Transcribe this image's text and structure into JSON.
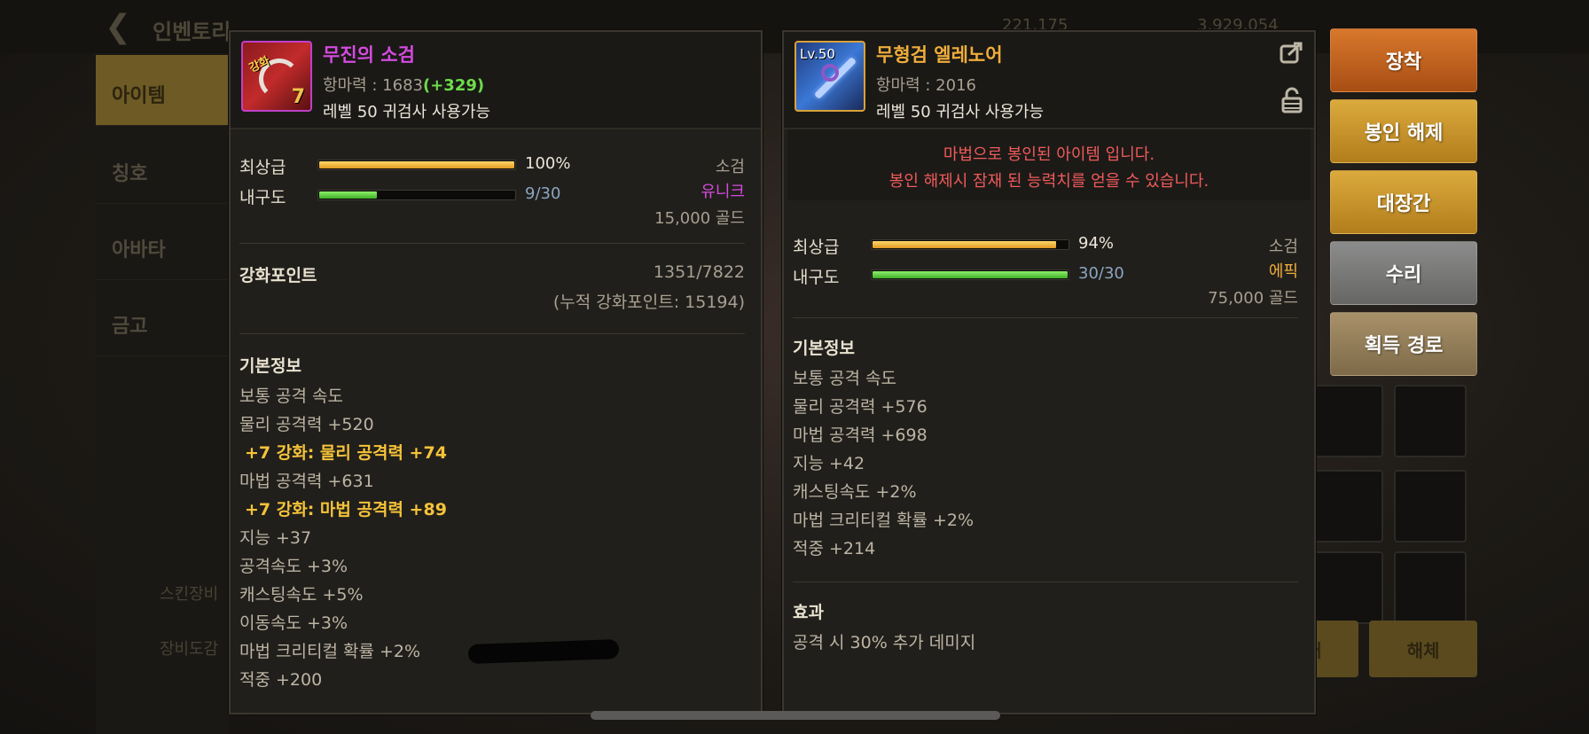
{
  "background": {
    "title": "인벤토리",
    "sidebar": [
      "아이템",
      "칭호",
      "아바타",
      "금고"
    ],
    "sidebar_bottom": [
      "스킨장비",
      "장비도감"
    ],
    "top_stats": [
      "221,175",
      "3,929,054"
    ],
    "bottom_buttons": [
      "판매",
      "해체"
    ]
  },
  "left_item": {
    "name": "무진의 소검",
    "attr_label": "항마력 : 1683",
    "attr_bonus": "(+329)",
    "requirement": "레벨 50 귀검사 사용가능",
    "icon_stamp": "강화",
    "icon_enhance": "7",
    "grade_label": "최상급",
    "grade_value": "100%",
    "grade_pct": 100,
    "durability_label": "내구도",
    "durability_value": "9/30",
    "durability_pct": 30,
    "item_type": "소검",
    "rarity": "유니크",
    "price": "15,000 골드",
    "enhance_points_label": "강화포인트",
    "enhance_points_value": "1351/7822",
    "enhance_points_total": "(누적 강화포인트: 15194)",
    "basic_info_title": "기본정보",
    "stats": [
      {
        "text": "보통 공격 속도",
        "enh": false
      },
      {
        "text": "물리 공격력 +520",
        "enh": false
      },
      {
        "text": "+7 강화: 물리 공격력 +74",
        "enh": true
      },
      {
        "text": "마법 공격력 +631",
        "enh": false
      },
      {
        "text": "+7 강화: 마법 공격력 +89",
        "enh": true
      },
      {
        "text": "지능 +37",
        "enh": false
      },
      {
        "text": "공격속도 +3%",
        "enh": false
      },
      {
        "text": "캐스팅속도 +5%",
        "enh": false
      },
      {
        "text": "이동속도 +3%",
        "enh": false
      },
      {
        "text": "마법 크리티컬 확률 +2%",
        "enh": false
      },
      {
        "text": "적중 +200",
        "enh": false
      }
    ]
  },
  "right_item": {
    "name": "무형검 엘레노어",
    "level_badge": "Lv.50",
    "attr_label": "항마력 : 2016",
    "requirement": "레벨 50 귀검사 사용가능",
    "warning_line1": "마법으로 봉인된 아이템 입니다.",
    "warning_line2": "봉인 해제시 잠재 된 능력치를 얻을 수 있습니다.",
    "grade_label": "최상급",
    "grade_value": "94%",
    "grade_pct": 94,
    "durability_label": "내구도",
    "durability_value": "30/30",
    "durability_pct": 100,
    "item_type": "소검",
    "rarity": "에픽",
    "price": "75,000 골드",
    "basic_info_title": "기본정보",
    "stats": [
      "보통 공격 속도",
      "물리 공격력 +576",
      "마법 공격력 +698",
      "지능 +42",
      "캐스팅속도 +2%",
      "마법 크리티컬 확률 +2%",
      "적중 +214"
    ],
    "effect_title": "효과",
    "effect_text": "공격 시 30% 추가 데미지"
  },
  "actions": {
    "equip": "장착",
    "unseal": "봉인 해제",
    "blacksmith": "대장간",
    "repair": "수리",
    "source": "획득 경로"
  },
  "icons": [
    "back-arrow-icon",
    "share-icon",
    "lock-icon"
  ]
}
